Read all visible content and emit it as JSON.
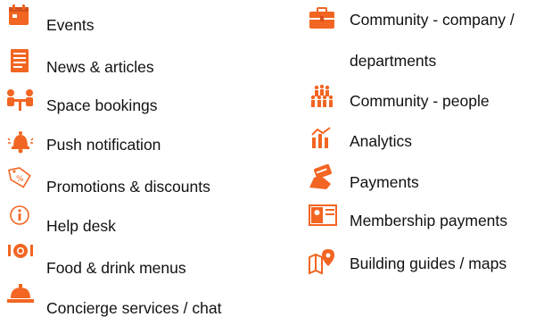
{
  "accent_color": "#f26522",
  "features": {
    "left": [
      {
        "icon": "calendar-icon",
        "label": "Events"
      },
      {
        "icon": "newspaper-icon",
        "label": "News & articles"
      },
      {
        "icon": "meeting-room-icon",
        "label": "Space bookings"
      },
      {
        "icon": "bell-notification-icon",
        "label": "Push notification"
      },
      {
        "icon": "discount-tag-icon",
        "label": "Promotions & discounts"
      },
      {
        "icon": "info-icon",
        "label": "Help desk"
      },
      {
        "icon": "cutlery-plate-icon",
        "label": "Food & drink menus"
      },
      {
        "icon": "service-bell-icon",
        "label": "Concierge services / chat"
      }
    ],
    "right": [
      {
        "icon": "briefcase-icon",
        "label": "Community - company /",
        "label2": "departments"
      },
      {
        "icon": "people-group-icon",
        "label": "Community - people"
      },
      {
        "icon": "analytics-icon",
        "label": "Analytics"
      },
      {
        "icon": "credit-card-hand-icon",
        "label": "Payments"
      },
      {
        "icon": "membership-card-icon",
        "label": "Membership payments"
      },
      {
        "icon": "map-pin-icon",
        "label": "Building guides / maps"
      }
    ]
  }
}
